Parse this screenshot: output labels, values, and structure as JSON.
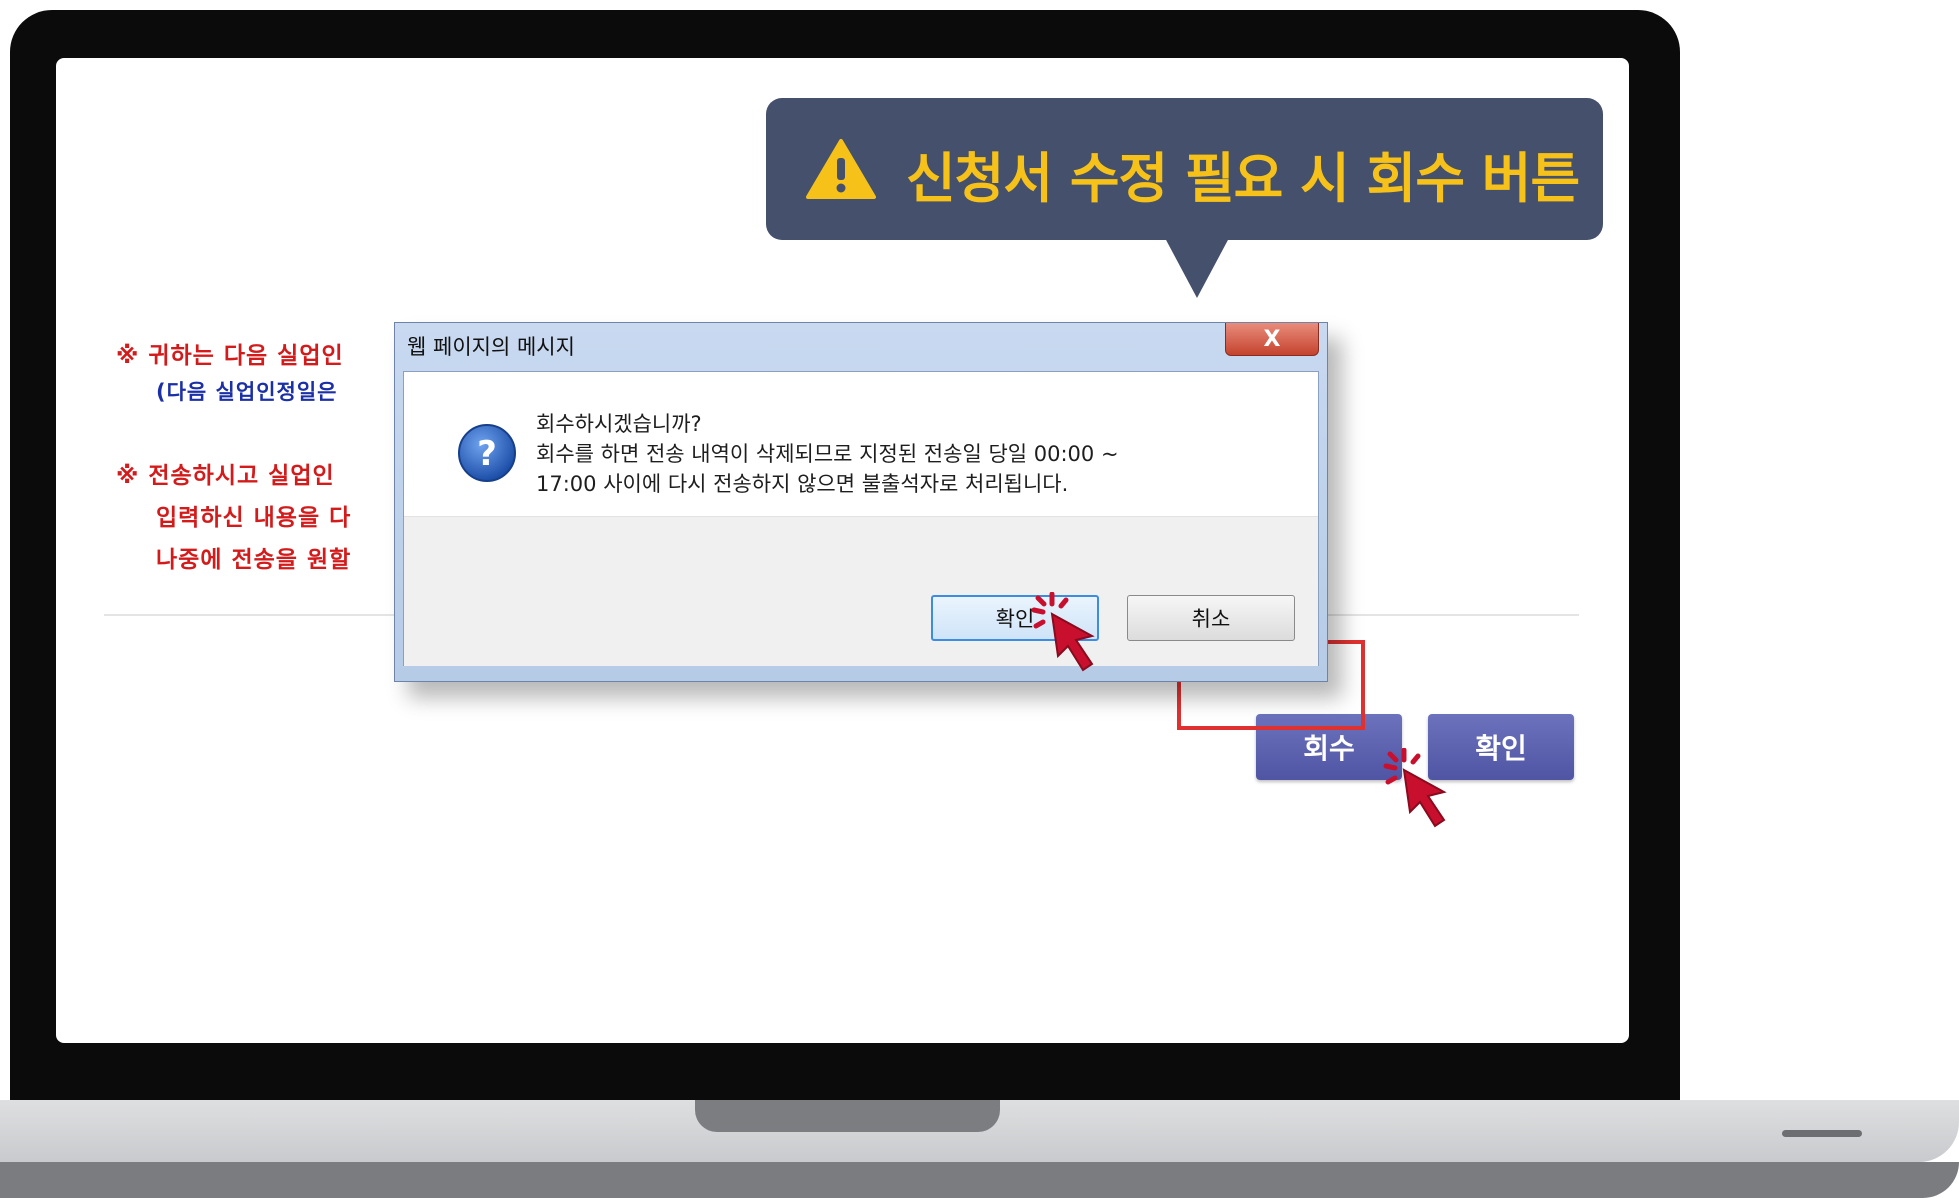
{
  "page": {
    "notes": [
      "※ 귀하는 다음 실업인",
      "(다음 실업인정일은",
      "※ 전송하시고 실업인",
      "입력하신 내용을 다",
      "나중에 전송을 원할"
    ],
    "buttons": {
      "withdraw": "회수",
      "confirm": "확인"
    }
  },
  "callout": {
    "text": "신청서 수정 필요 시 회수 버튼",
    "icon": "warning-icon",
    "text_color": "#f6c21a",
    "bg_color": "#44506c"
  },
  "dialog": {
    "title": "웹 페이지의 메시지",
    "close_label": "X",
    "question": "회수하시겠습니까?",
    "line1": "회수를 하면 전송 내역이 삭제되므로 지정된 전송일 당일 00:00 ~",
    "line2": "17:00 사이에 다시 전송하지 않으면 불출석자로 처리됩니다.",
    "ok_label": "확인",
    "cancel_label": "취소",
    "icon": "question-icon"
  },
  "colors": {
    "page_button": "#5a5fae",
    "highlight": "#e03131",
    "note_red": "#d41b1b",
    "note_blue": "#1b2fa6"
  }
}
